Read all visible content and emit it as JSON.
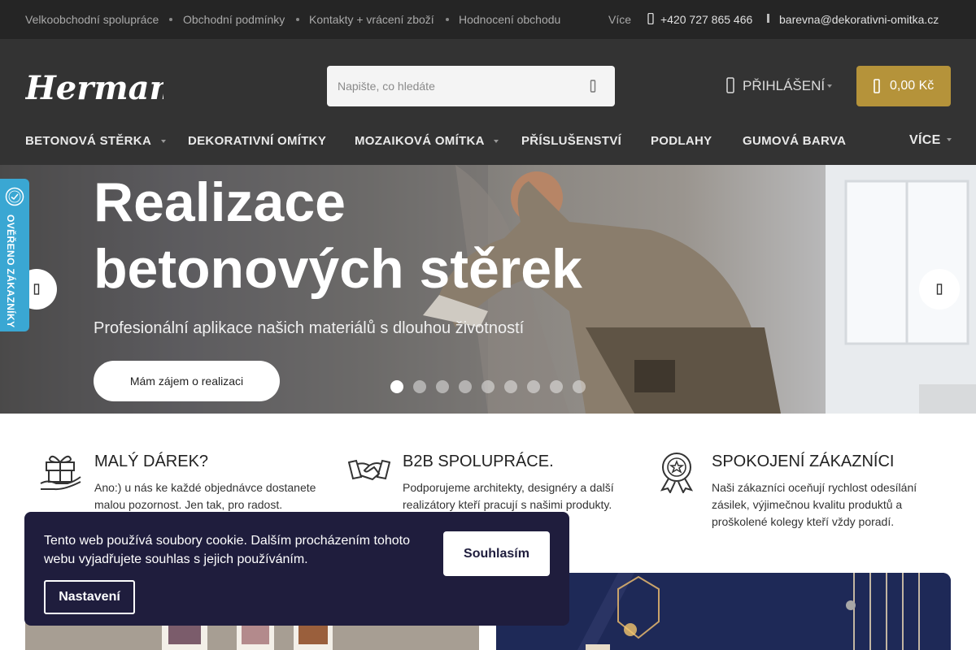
{
  "topbar": {
    "links": [
      "Velkoobchodní spolupráce",
      "Obchodní podmínky",
      "Kontakty + vrácení zboží",
      "Hodnocení obchodu"
    ],
    "more": "Více",
    "phone": "+420 727 865 466",
    "email": "barevna@dekorativni-omitka.cz"
  },
  "header": {
    "logo_text": "Hermann",
    "search_placeholder": "Napište, co hledáte",
    "login_label": "PŘIHLÁŠENÍ",
    "cart_label": "0,00 Kč"
  },
  "nav": {
    "items": [
      "BETONOVÁ STĚRKA",
      "DEKORATIVNÍ OMÍTKY",
      "MOZAIKOVÁ OMÍTKA",
      "PŘÍSLUŠENSTVÍ",
      "PODLAHY",
      "GUMOVÁ BARVA"
    ],
    "more": "VÍCE"
  },
  "hero": {
    "title_line1": "Realizace",
    "title_line2": "betonových stěrek",
    "subtitle": "Profesionální aplikace našich materiálů s dlouhou životností",
    "cta": "Mám zájem o realizaci",
    "slide_count": 9,
    "active_slide": 1
  },
  "badge": {
    "label": "OVĚŘENO ZÁKAZNÍKY",
    "seal_text": "OVĚŘENO ZÁKAZNÍKY"
  },
  "features": [
    {
      "title": "MALÝ DÁREK?",
      "text": "Ano:) u nás ke každé objednávce dostanete malou pozornost. Jen tak, pro radost.",
      "icon": "gift-icon"
    },
    {
      "title": "B2B SPOLUPRÁCE.",
      "text": "Podporujeme architekty, designéry a další realizátory kteří pracují s našimi produkty.",
      "icon": "handshake-icon"
    },
    {
      "title": "SPOKOJENÍ ZÁKAZNÍCI",
      "text": "Naši zákazníci oceňují rychlost odesílání zásilek, výjimečnou kvalitu produktů a proškolené kolegy kteří vždy poradí.",
      "icon": "award-icon"
    }
  ],
  "cookie": {
    "text": "Tento web používá soubory cookie. Dalším procházením tohoto webu vyjadřujete souhlas s jejich používáním.",
    "accept": "Souhlasím",
    "settings": "Nastavení"
  },
  "colors": {
    "topbar": "#252525",
    "header": "#333333",
    "cart": "#b5933a",
    "badge": "#3aa7d3",
    "cookie": "#1f1d3d"
  }
}
